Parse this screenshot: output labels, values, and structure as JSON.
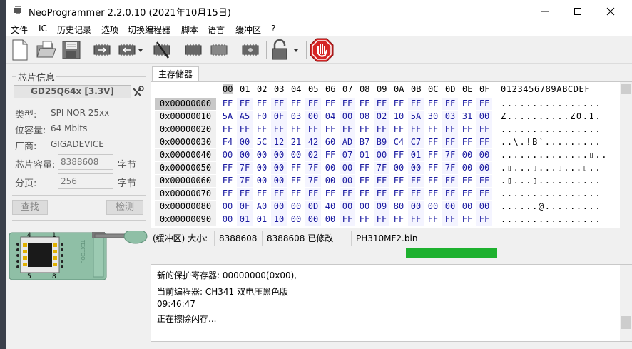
{
  "window": {
    "title": "NeoProgrammer 2.2.0.10 (2021年10月15日)",
    "controls": [
      "—",
      "☐",
      "✕"
    ]
  },
  "menu": [
    "文件",
    "IC",
    "历史记录",
    "选项",
    "切换编程器",
    "脚本",
    "语言",
    "缓冲区",
    "?"
  ],
  "toolbar": {
    "icons": [
      "new-file-icon",
      "open-folder-icon",
      "save-disk-icon",
      "read-chip-icon",
      "write-chip-icon",
      "erase-chip-icon",
      "verify-chip-icon",
      "blank-check-icon",
      "auto-chip-icon",
      "lock-icon",
      "stop-hand-icon"
    ]
  },
  "chip": {
    "group_title": "芯片信息",
    "name": "GD25Q64x [3.3V]",
    "type_label": "类型:",
    "type_value": "SPI NOR 25xx",
    "capacity_label": "位容量:",
    "capacity_value": "64 Mbits",
    "vendor_label": "厂商:",
    "vendor_value": "GIGADEVICE",
    "size_label": "芯片容量:",
    "size_value": "8388608",
    "size_unit": "字节",
    "page_label": "分页:",
    "page_value": "256",
    "page_unit": "字节",
    "find_button": "查找",
    "detect_button": "检测",
    "socket_brand": "TEXTOOL",
    "pin_labels": [
      "4",
      "1",
      "5",
      "8"
    ]
  },
  "tab": "主存储器",
  "hex": {
    "header_cols": [
      "00",
      "01",
      "02",
      "03",
      "04",
      "05",
      "06",
      "07",
      "08",
      "09",
      "0A",
      "0B",
      "0C",
      "0D",
      "0E",
      "0F"
    ],
    "ascii_header": "0123456789ABCDEF",
    "rows": [
      {
        "addr": "0x00000000",
        "bytes": [
          "FF",
          "FF",
          "FF",
          "FF",
          "FF",
          "FF",
          "FF",
          "FF",
          "FF",
          "FF",
          "FF",
          "FF",
          "FF",
          "FF",
          "FF",
          "FF"
        ],
        "ascii": "................"
      },
      {
        "addr": "0x00000010",
        "bytes": [
          "5A",
          "A5",
          "F0",
          "0F",
          "03",
          "00",
          "04",
          "00",
          "08",
          "02",
          "10",
          "5A",
          "30",
          "03",
          "31",
          "00"
        ],
        "ascii": "Z..........Z0.1."
      },
      {
        "addr": "0x00000020",
        "bytes": [
          "FF",
          "FF",
          "FF",
          "FF",
          "FF",
          "FF",
          "FF",
          "FF",
          "FF",
          "FF",
          "FF",
          "FF",
          "FF",
          "FF",
          "FF",
          "FF"
        ],
        "ascii": "................"
      },
      {
        "addr": "0x00000030",
        "bytes": [
          "F4",
          "00",
          "5C",
          "12",
          "21",
          "42",
          "60",
          "AD",
          "B7",
          "B9",
          "C4",
          "C7",
          "FF",
          "FF",
          "FF",
          "FF"
        ],
        "ascii": "..\\.!B`........."
      },
      {
        "addr": "0x00000040",
        "bytes": [
          "00",
          "00",
          "00",
          "00",
          "00",
          "02",
          "FF",
          "07",
          "01",
          "00",
          "FF",
          "01",
          "FF",
          "7F",
          "00",
          "00"
        ],
        "ascii": "..............▯.."
      },
      {
        "addr": "0x00000050",
        "bytes": [
          "FF",
          "7F",
          "00",
          "00",
          "FF",
          "7F",
          "00",
          "00",
          "FF",
          "7F",
          "00",
          "00",
          "FF",
          "7F",
          "00",
          "00"
        ],
        "ascii": ".▯...▯...▯...▯.."
      },
      {
        "addr": "0x00000060",
        "bytes": [
          "FF",
          "7F",
          "00",
          "00",
          "FF",
          "7F",
          "00",
          "00",
          "FF",
          "FF",
          "FF",
          "FF",
          "FF",
          "FF",
          "FF",
          "FF"
        ],
        "ascii": ".▯...▯.........."
      },
      {
        "addr": "0x00000070",
        "bytes": [
          "FF",
          "FF",
          "FF",
          "FF",
          "FF",
          "FF",
          "FF",
          "FF",
          "FF",
          "FF",
          "FF",
          "FF",
          "FF",
          "FF",
          "FF",
          "FF"
        ],
        "ascii": "................"
      },
      {
        "addr": "0x00000080",
        "bytes": [
          "00",
          "0F",
          "A0",
          "00",
          "00",
          "0D",
          "40",
          "00",
          "00",
          "09",
          "80",
          "00",
          "00",
          "00",
          "00",
          "00"
        ],
        "ascii": "......@........."
      },
      {
        "addr": "0x00000090",
        "bytes": [
          "00",
          "01",
          "01",
          "10",
          "00",
          "00",
          "00",
          "FF",
          "FF",
          "FF",
          "FF",
          "FF",
          "FF",
          "FF",
          "FF",
          "FF"
        ],
        "ascii": "................"
      }
    ]
  },
  "status": {
    "buffer_label": "(缓冲区) 大小:",
    "size": "8388608",
    "modified": "8388608 已修改",
    "filename": "PH310MF2.bin"
  },
  "progress_fraction": 0.19,
  "log": [
    "新的保护寄存器:  00000000(0x00),",
    "当前编程器: CH341 双电压黑色版",
    "09:46:47",
    "正在擦除闪存..."
  ]
}
